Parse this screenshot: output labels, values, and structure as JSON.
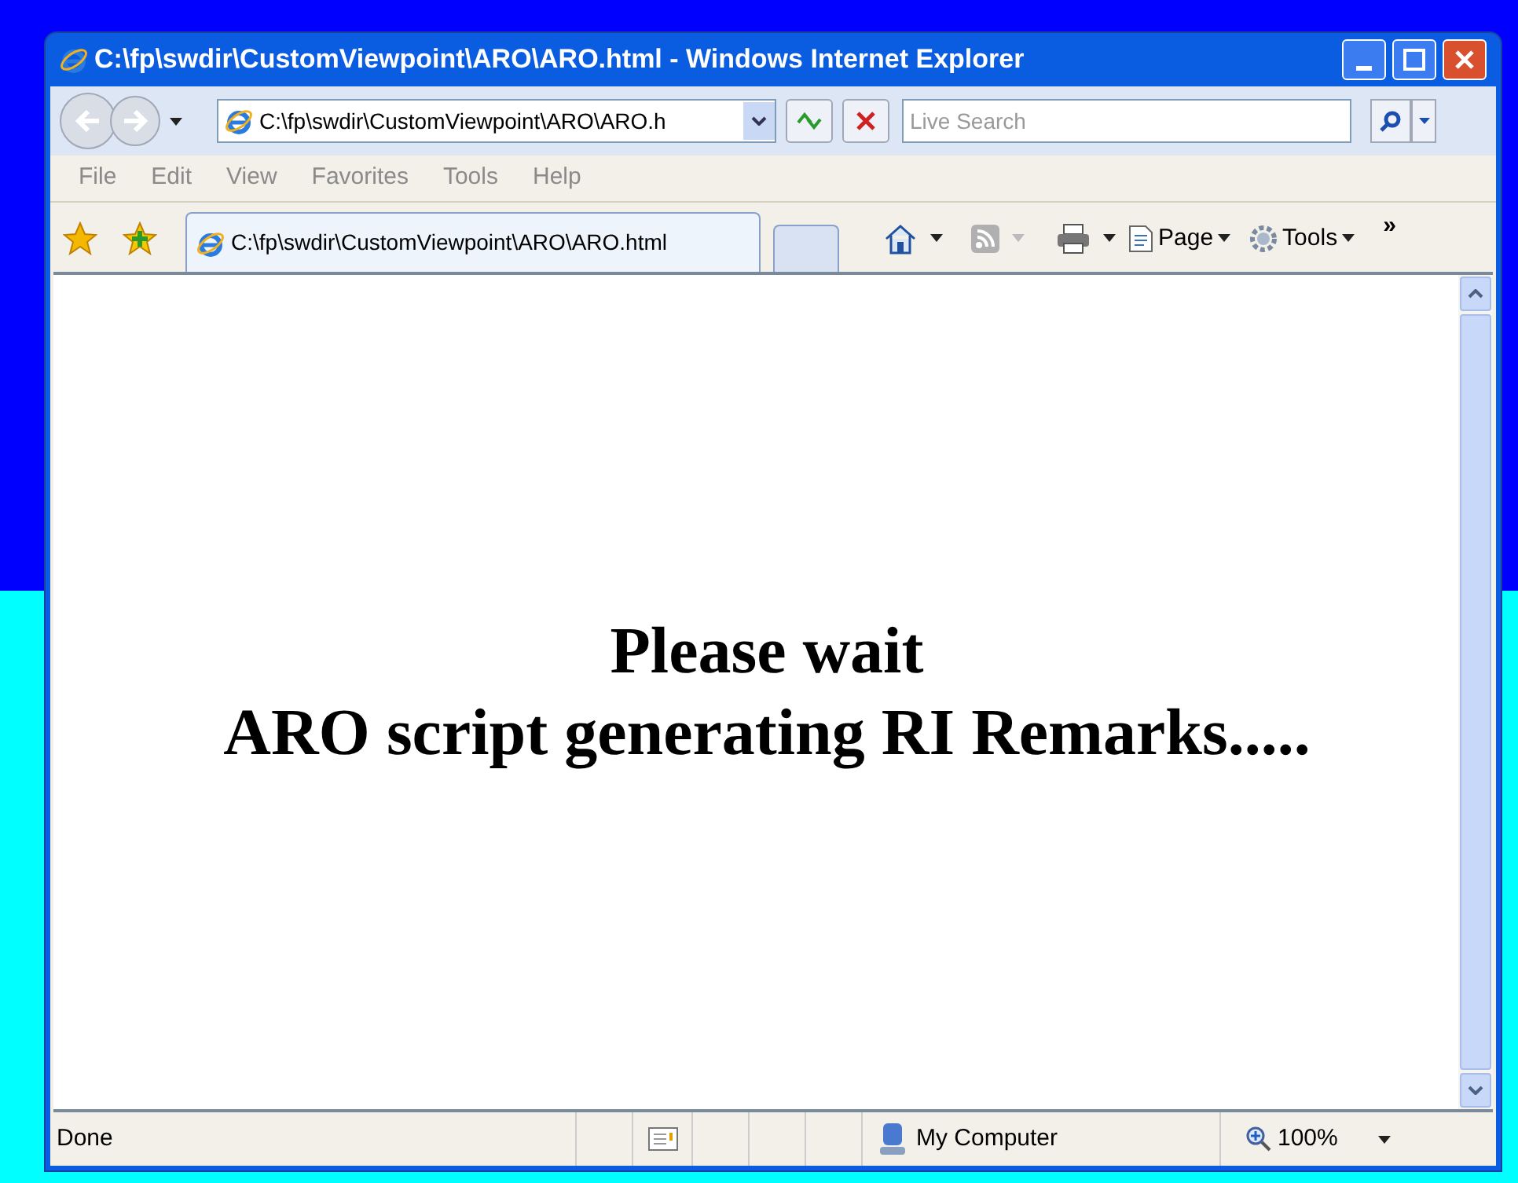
{
  "window": {
    "title": "C:\\fp\\swdir\\CustomViewpoint\\ARO\\ARO.html - Windows Internet Explorer"
  },
  "address_bar": {
    "value": "C:\\fp\\swdir\\CustomViewpoint\\ARO\\ARO.h"
  },
  "search": {
    "placeholder": "Live Search"
  },
  "menu": [
    "File",
    "Edit",
    "View",
    "Favorites",
    "Tools",
    "Help"
  ],
  "tabs": [
    {
      "label": "C:\\fp\\swdir\\CustomViewpoint\\ARO\\ARO.html",
      "selected": true
    }
  ],
  "command_bar": {
    "page": "Page",
    "tools": "Tools",
    "more": "»"
  },
  "content": {
    "lines": [
      "Please wait",
      "ARO script generating RI Remarks....."
    ]
  },
  "status_bar": {
    "status": "Done",
    "zone": "My Computer",
    "zoom": "100%"
  }
}
